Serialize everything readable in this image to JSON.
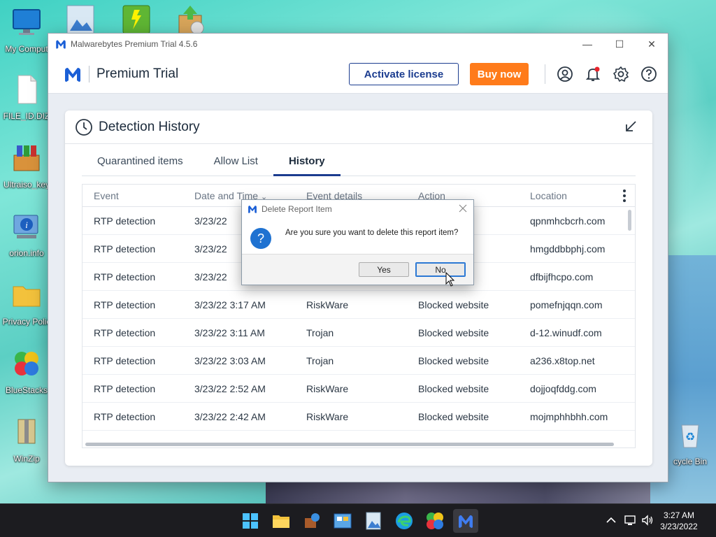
{
  "desktop": {
    "icons": [
      {
        "label": "My Comput"
      },
      {
        "label": "FILE_ID.DIZ"
      },
      {
        "label": "Ultraiso_key"
      },
      {
        "label": "orion.info"
      },
      {
        "label": "Privacy Polic"
      },
      {
        "label": "BlueStacks"
      },
      {
        "label": "WinZip"
      },
      {
        "label": "cycle Bin"
      }
    ]
  },
  "window": {
    "title": "Malwarebytes Premium Trial  4.5.6",
    "controls": {
      "minimize": "—",
      "maximize": "☐",
      "close": "✕"
    }
  },
  "appbar": {
    "title": "Premium Trial",
    "activate_label": "Activate license",
    "buy_label": "Buy now"
  },
  "card": {
    "title": "Detection History",
    "tabs": [
      {
        "label": "Quarantined items"
      },
      {
        "label": "Allow List"
      },
      {
        "label": "History",
        "active": true
      }
    ],
    "columns": [
      "Event",
      "Date and Time",
      "Event details",
      "Action",
      "Location"
    ],
    "rows": [
      {
        "event": "RTP detection",
        "date": "3/23/22",
        "details": "",
        "action": "ebsite",
        "location": "qpnmhcbcrh.com"
      },
      {
        "event": "RTP detection",
        "date": "3/23/22",
        "details": "",
        "action": "ebsite",
        "location": "hmgddbbphj.com"
      },
      {
        "event": "RTP detection",
        "date": "3/23/22",
        "details": "",
        "action": "ebsite",
        "location": "dfbijfhcpo.com"
      },
      {
        "event": "RTP detection",
        "date": "3/23/22 3:17 AM",
        "details": "RiskWare",
        "action": "Blocked website",
        "location": "pomefnjqqn.com"
      },
      {
        "event": "RTP detection",
        "date": "3/23/22 3:11 AM",
        "details": "Trojan",
        "action": "Blocked website",
        "location": "d-12.winudf.com"
      },
      {
        "event": "RTP detection",
        "date": "3/23/22 3:03 AM",
        "details": "Trojan",
        "action": "Blocked website",
        "location": "a236.x8top.net"
      },
      {
        "event": "RTP detection",
        "date": "3/23/22 2:52 AM",
        "details": "RiskWare",
        "action": "Blocked website",
        "location": "dojjoqfddg.com"
      },
      {
        "event": "RTP detection",
        "date": "3/23/22 2:42 AM",
        "details": "RiskWare",
        "action": "Blocked website",
        "location": "mojmphhbhh.com"
      }
    ]
  },
  "dialog": {
    "title": "Delete Report Item",
    "message": "Are you sure you want to delete this report item?",
    "yes_label": "Yes",
    "no_label": "No"
  },
  "taskbar": {
    "time": "3:27 AM",
    "date": "3/23/2022"
  },
  "colors": {
    "brand_blue": "#1b3c8f",
    "buy_orange": "#ff7b1a",
    "notification_red": "#e8232b"
  }
}
